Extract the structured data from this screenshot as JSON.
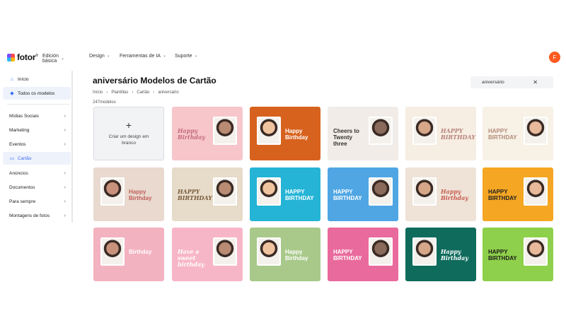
{
  "brand": {
    "name": "fotor",
    "mark": "®"
  },
  "nav": [
    {
      "label": "Edición básica"
    },
    {
      "label": "Design"
    },
    {
      "label": "Ferramentas de IA"
    },
    {
      "label": "Suporte"
    }
  ],
  "user": {
    "initial": "F"
  },
  "sidebar": {
    "top": [
      {
        "label": "Início",
        "icon": "home-icon"
      },
      {
        "label": "Todos os modelos",
        "icon": "cube-icon"
      }
    ],
    "items": [
      {
        "label": "Mídias Sociais"
      },
      {
        "label": "Marketing"
      },
      {
        "label": "Eventos"
      },
      {
        "label": "Cartão",
        "icon": "card-icon"
      },
      {
        "label": "Anúncios"
      },
      {
        "label": "Documentos"
      },
      {
        "label": "Para sempre"
      },
      {
        "label": "Montagens de fotos"
      }
    ]
  },
  "page": {
    "title": "aniversário Modelos de Cartão",
    "breadcrumb": [
      "Início",
      "Plantillas",
      "Cartão",
      "aniversário"
    ],
    "count": "247modelos"
  },
  "search": {
    "value": "aniversário"
  },
  "blank_card": {
    "label": "Criar um design em branco"
  },
  "templates": [
    {
      "text": "Happy Birthday",
      "bg": "#f6c6cb",
      "accent": "#c56b7a"
    },
    {
      "text": "Happy Birthday",
      "bg": "#d7621e",
      "accent": "#ffffff"
    },
    {
      "text": "Cheers to Twenty three",
      "bg": "#f1ece7",
      "accent": "#333333"
    },
    {
      "text": "HAPPY BIRTHDAY",
      "bg": "#f6ede3",
      "accent": "#b9837a"
    },
    {
      "text": "HAPPY BIRTHDAY",
      "bg": "#f7f1e6",
      "accent": "#b38b7a"
    },
    {
      "text": "Happy Birthday",
      "bg": "#e9d9cf",
      "accent": "#c0605b"
    },
    {
      "text": "HAPPY BIRTHDAY",
      "bg": "#e7dbc9",
      "accent": "#7a5c3c"
    },
    {
      "text": "HAPPY BIRTHDAY",
      "bg": "#25b4d6",
      "accent": "#ffffff"
    },
    {
      "text": "HAPPY BIRTHDAY",
      "bg": "#4fa6e3",
      "accent": "#ffffff"
    },
    {
      "text": "Happy Birthday",
      "bg": "#efe3d8",
      "accent": "#c95b4e"
    },
    {
      "text": "HAPPY BIRTHDAY",
      "bg": "#f5a623",
      "accent": "#1f1f1f"
    },
    {
      "text": "Birthday",
      "bg": "#f3b2c0",
      "accent": "#ffffff"
    },
    {
      "text": "Have a sweet birthday",
      "bg": "#f7b6c8",
      "accent": "#ffffff"
    },
    {
      "text": "Happy Birthday",
      "bg": "#a8c98a",
      "accent": "#ffffff"
    },
    {
      "text": "HAPPY BIRTHDAY",
      "bg": "#e96a9c",
      "accent": "#ffffff"
    },
    {
      "text": "Happy Birthday",
      "bg": "#0f6b5c",
      "accent": "#ffffff"
    },
    {
      "text": "HAPPY BIRTHDAY",
      "bg": "#8ed04b",
      "accent": "#1a1a1a"
    }
  ],
  "colors": {
    "accent": "#3a6cf4",
    "avatar": "#ff5a1f"
  }
}
